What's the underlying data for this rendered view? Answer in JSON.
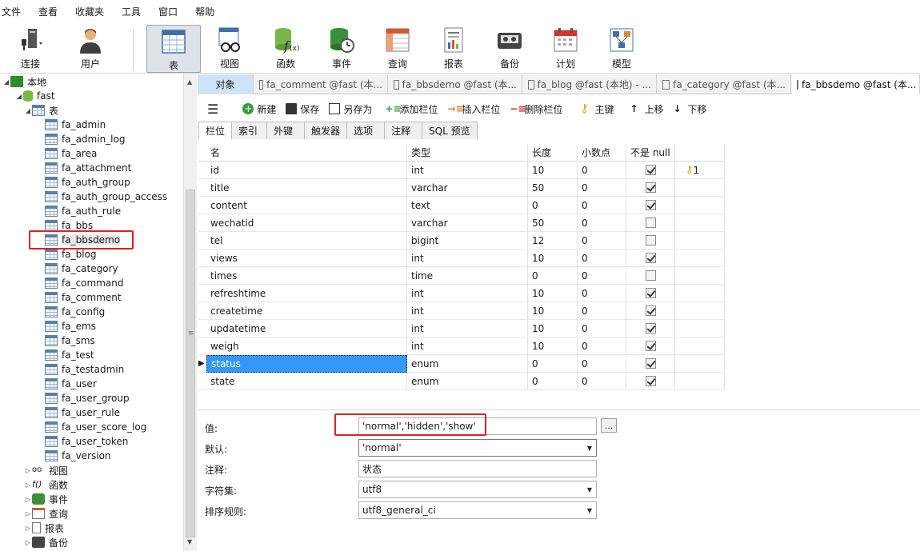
{
  "menu": [
    "文件",
    "查看",
    "收藏夹",
    "工具",
    "窗口",
    "帮助"
  ],
  "toolbar": {
    "connect": "连接",
    "user": "用户",
    "table": "表",
    "view": "视图",
    "function": "函数",
    "event": "事件",
    "query": "查询",
    "report": "报表",
    "backup": "备份",
    "schedule": "计划",
    "model": "模型"
  },
  "tree": {
    "local": "本地",
    "db": "fast",
    "tables_label": "表",
    "tables": [
      "fa_admin",
      "fa_admin_log",
      "fa_area",
      "fa_attachment",
      "fa_auth_group",
      "fa_auth_group_access",
      "fa_auth_rule",
      "fa_bbs",
      "fa_bbsdemo",
      "fa_blog",
      "fa_category",
      "fa_command",
      "fa_comment",
      "fa_config",
      "fa_ems",
      "fa_sms",
      "fa_test",
      "fa_testadmin",
      "fa_user",
      "fa_user_group",
      "fa_user_rule",
      "fa_user_score_log",
      "fa_user_token",
      "fa_version"
    ],
    "selected": "fa_bbsdemo",
    "others": [
      "视图",
      "函数",
      "事件",
      "查询",
      "报表",
      "备份"
    ]
  },
  "tabs": {
    "objects": "对象",
    "t1": "fa_comment @fast (本...",
    "t2": "fa_bbsdemo @fast (本...",
    "t3": "fa_blog @fast (本地) - ...",
    "t4": "fa_category @fast (本...",
    "t5": "fa_bbsdemo @fast (本..."
  },
  "editor_toolbar": {
    "new": "新建",
    "save": "保存",
    "save_as": "另存为",
    "add_field": "添加栏位",
    "insert_field": "插入栏位",
    "delete_field": "删除栏位",
    "primary_key": "主键",
    "move_up": "上移",
    "move_down": "下移"
  },
  "subtabs": [
    "栏位",
    "索引",
    "外键",
    "触发器",
    "选项",
    "注释",
    "SQL 预览"
  ],
  "grid": {
    "headers": [
      "名",
      "类型",
      "长度",
      "小数点",
      "不是 null",
      ""
    ],
    "rows": [
      {
        "name": "id",
        "type": "int",
        "len": "10",
        "dec": "0",
        "notnull": true,
        "key": "1"
      },
      {
        "name": "title",
        "type": "varchar",
        "len": "50",
        "dec": "0",
        "notnull": true,
        "key": ""
      },
      {
        "name": "content",
        "type": "text",
        "len": "0",
        "dec": "0",
        "notnull": true,
        "key": ""
      },
      {
        "name": "wechatid",
        "type": "varchar",
        "len": "50",
        "dec": "0",
        "notnull": false,
        "key": ""
      },
      {
        "name": "tel",
        "type": "bigint",
        "len": "12",
        "dec": "0",
        "notnull": false,
        "key": ""
      },
      {
        "name": "views",
        "type": "int",
        "len": "10",
        "dec": "0",
        "notnull": true,
        "key": ""
      },
      {
        "name": "times",
        "type": "time",
        "len": "0",
        "dec": "0",
        "notnull": false,
        "key": ""
      },
      {
        "name": "refreshtime",
        "type": "int",
        "len": "10",
        "dec": "0",
        "notnull": true,
        "key": ""
      },
      {
        "name": "createtime",
        "type": "int",
        "len": "10",
        "dec": "0",
        "notnull": true,
        "key": ""
      },
      {
        "name": "updatetime",
        "type": "int",
        "len": "10",
        "dec": "0",
        "notnull": true,
        "key": ""
      },
      {
        "name": "weigh",
        "type": "int",
        "len": "10",
        "dec": "0",
        "notnull": true,
        "key": ""
      },
      {
        "name": "status",
        "type": "enum",
        "len": "0",
        "dec": "0",
        "notnull": true,
        "key": ""
      },
      {
        "name": "state",
        "type": "enum",
        "len": "0",
        "dec": "0",
        "notnull": true,
        "key": ""
      }
    ],
    "selected_row": 11
  },
  "props": {
    "value_label": "值:",
    "value": "'normal','hidden','show'",
    "ellipsis": "...",
    "default_label": "默认:",
    "default_value": "'normal'",
    "comment_label": "注释:",
    "comment_value": "状态",
    "charset_label": "字符集:",
    "charset_value": "utf8",
    "collation_label": "排序规则:",
    "collation_value": "utf8_general_ci"
  },
  "colors": {
    "highlight_red": "#e02020",
    "selection_blue": "#3399ff",
    "object_tab": "#cfe3f6"
  }
}
